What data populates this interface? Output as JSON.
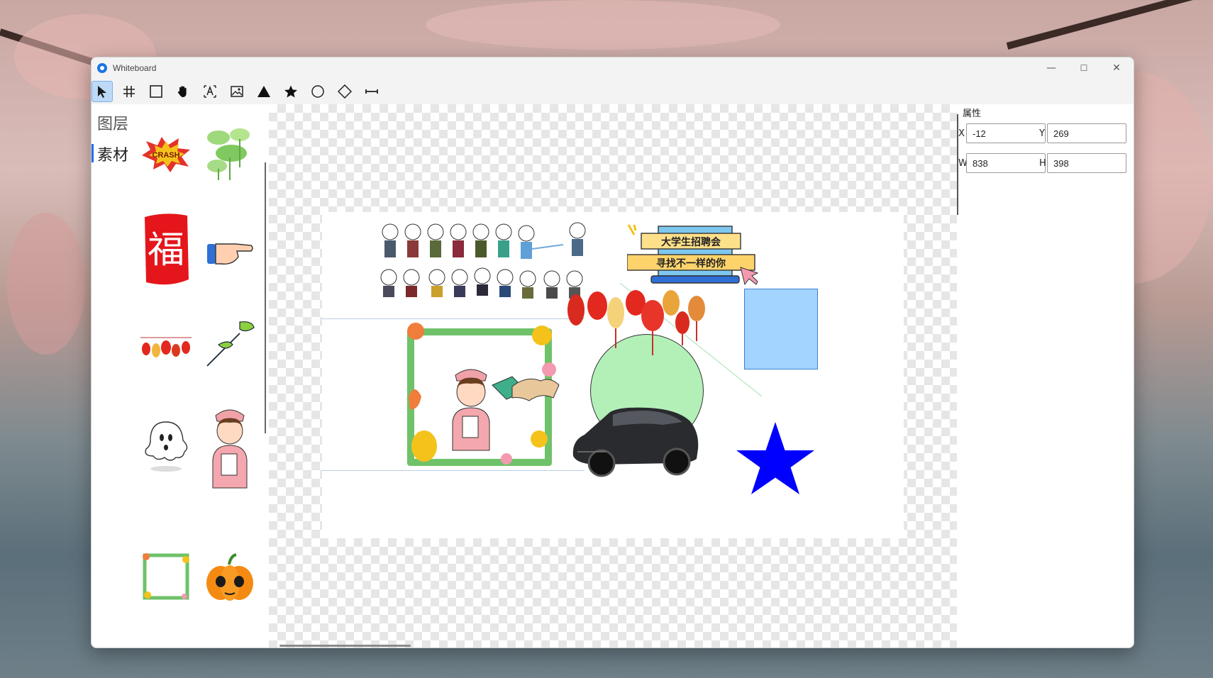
{
  "window": {
    "title": "Whiteboard"
  },
  "window_controls": {
    "minimize": "—",
    "maximize": "☐",
    "close": "✕"
  },
  "toolbar": {
    "tools": [
      {
        "name": "select-tool",
        "icon": "arrow-pointer-icon",
        "active": true
      },
      {
        "name": "grid-tool",
        "icon": "hash-icon"
      },
      {
        "name": "rectangle-tool",
        "icon": "square-icon"
      },
      {
        "name": "pan-tool",
        "icon": "hand-icon"
      },
      {
        "name": "text-tool",
        "icon": "text-box-icon"
      },
      {
        "name": "image-tool",
        "icon": "image-icon"
      },
      {
        "name": "triangle-tool",
        "icon": "triangle-icon"
      },
      {
        "name": "star-tool",
        "icon": "star-icon"
      },
      {
        "name": "circle-tool",
        "icon": "circle-icon"
      },
      {
        "name": "diamond-tool",
        "icon": "diamond-icon"
      },
      {
        "name": "line-tool",
        "icon": "line-arrow-icon"
      }
    ]
  },
  "left_panel": {
    "tabs": [
      {
        "label": "图层"
      },
      {
        "label": "素材"
      }
    ],
    "assets": [
      {
        "name": "crash-sticker"
      },
      {
        "name": "lotus-leaves"
      },
      {
        "name": "fu-seal",
        "text": "福"
      },
      {
        "name": "pointing-hand"
      },
      {
        "name": "lanterns"
      },
      {
        "name": "green-leaves"
      },
      {
        "name": "ghost"
      },
      {
        "name": "nurse"
      },
      {
        "name": "flower-frame"
      },
      {
        "name": "pumpkin"
      }
    ]
  },
  "canvas": {
    "banner": {
      "line1": "大学生招聘会",
      "line2": "寻找不一样的你"
    },
    "colors": {
      "rect": "#a3d4ff",
      "rect_border": "#3d7fd3",
      "circle": "#b3f0b8",
      "star": "#0000ff",
      "frame": "#6fc26a"
    }
  },
  "properties": {
    "title": "属性",
    "x_label": "X",
    "x_value": "-12",
    "y_label": "Y",
    "y_value": "269",
    "w_label": "W",
    "w_value": "838",
    "h_label": "H",
    "h_value": "398"
  }
}
